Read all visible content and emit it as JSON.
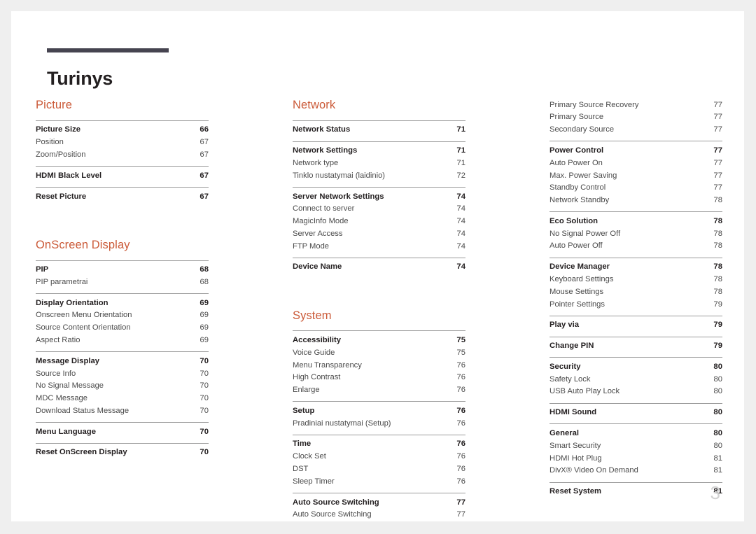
{
  "document": {
    "title": "Turinys",
    "page_number": "3",
    "accent_color": "#cb5a38",
    "rule_color": "#464450"
  },
  "columns": [
    {
      "name": "column-left",
      "sections": [
        {
          "heading": "Picture",
          "groups": [
            {
              "rows": [
                {
                  "label": "Picture Size",
                  "page": "66",
                  "level": "main"
                },
                {
                  "label": "Position",
                  "page": "67",
                  "level": "sub"
                },
                {
                  "label": "Zoom/Position",
                  "page": "67",
                  "level": "sub"
                }
              ]
            },
            {
              "rows": [
                {
                  "label": "HDMI Black Level",
                  "page": "67",
                  "level": "main"
                }
              ]
            },
            {
              "rows": [
                {
                  "label": "Reset Picture",
                  "page": "67",
                  "level": "main"
                }
              ]
            }
          ]
        },
        {
          "heading": "OnScreen Display",
          "groups": [
            {
              "rows": [
                {
                  "label": "PIP",
                  "page": "68",
                  "level": "main"
                },
                {
                  "label": "PIP parametrai",
                  "page": "68",
                  "level": "sub"
                }
              ]
            },
            {
              "rows": [
                {
                  "label": "Display Orientation",
                  "page": "69",
                  "level": "main"
                },
                {
                  "label": "Onscreen Menu Orientation",
                  "page": "69",
                  "level": "sub"
                },
                {
                  "label": "Source Content Orientation",
                  "page": "69",
                  "level": "sub"
                },
                {
                  "label": "Aspect Ratio",
                  "page": "69",
                  "level": "sub"
                }
              ]
            },
            {
              "rows": [
                {
                  "label": "Message Display",
                  "page": "70",
                  "level": "main"
                },
                {
                  "label": "Source Info",
                  "page": "70",
                  "level": "sub"
                },
                {
                  "label": "No Signal Message",
                  "page": "70",
                  "level": "sub"
                },
                {
                  "label": "MDC Message",
                  "page": "70",
                  "level": "sub"
                },
                {
                  "label": "Download Status Message",
                  "page": "70",
                  "level": "sub"
                }
              ]
            },
            {
              "rows": [
                {
                  "label": "Menu Language",
                  "page": "70",
                  "level": "main"
                }
              ]
            },
            {
              "rows": [
                {
                  "label": "Reset OnScreen Display",
                  "page": "70",
                  "level": "main"
                }
              ]
            }
          ]
        }
      ]
    },
    {
      "name": "column-middle",
      "sections": [
        {
          "heading": "Network",
          "groups": [
            {
              "rows": [
                {
                  "label": "Network Status",
                  "page": "71",
                  "level": "main"
                }
              ]
            },
            {
              "rows": [
                {
                  "label": "Network Settings",
                  "page": "71",
                  "level": "main"
                },
                {
                  "label": "Network type",
                  "page": "71",
                  "level": "sub"
                },
                {
                  "label": "Tinklo nustatymai (laidinio)",
                  "page": "72",
                  "level": "sub"
                }
              ]
            },
            {
              "rows": [
                {
                  "label": "Server Network Settings",
                  "page": "74",
                  "level": "main"
                },
                {
                  "label": "Connect to server",
                  "page": "74",
                  "level": "sub"
                },
                {
                  "label": "MagicInfo Mode",
                  "page": "74",
                  "level": "sub"
                },
                {
                  "label": "Server Access",
                  "page": "74",
                  "level": "sub"
                },
                {
                  "label": "FTP Mode",
                  "page": "74",
                  "level": "sub"
                }
              ]
            },
            {
              "rows": [
                {
                  "label": "Device Name",
                  "page": "74",
                  "level": "main"
                }
              ]
            }
          ]
        },
        {
          "heading": "System",
          "groups": [
            {
              "rows": [
                {
                  "label": "Accessibility",
                  "page": "75",
                  "level": "main"
                },
                {
                  "label": "Voice Guide",
                  "page": "75",
                  "level": "sub"
                },
                {
                  "label": "Menu Transparency",
                  "page": "76",
                  "level": "sub"
                },
                {
                  "label": "High Contrast",
                  "page": "76",
                  "level": "sub"
                },
                {
                  "label": "Enlarge",
                  "page": "76",
                  "level": "sub"
                }
              ]
            },
            {
              "rows": [
                {
                  "label": "Setup",
                  "page": "76",
                  "level": "main"
                },
                {
                  "label": "Pradiniai nustatymai (Setup)",
                  "page": "76",
                  "level": "sub"
                }
              ]
            },
            {
              "rows": [
                {
                  "label": "Time",
                  "page": "76",
                  "level": "main"
                },
                {
                  "label": "Clock Set",
                  "page": "76",
                  "level": "sub"
                },
                {
                  "label": "DST",
                  "page": "76",
                  "level": "sub"
                },
                {
                  "label": "Sleep Timer",
                  "page": "76",
                  "level": "sub"
                }
              ]
            },
            {
              "rows": [
                {
                  "label": "Auto Source Switching",
                  "page": "77",
                  "level": "main"
                },
                {
                  "label": "Auto Source Switching",
                  "page": "77",
                  "level": "sub"
                }
              ]
            }
          ]
        }
      ]
    },
    {
      "name": "column-right",
      "sections": [
        {
          "heading": "",
          "groups": [
            {
              "no_rule": true,
              "rows": [
                {
                  "label": "Primary Source Recovery",
                  "page": "77",
                  "level": "sub"
                },
                {
                  "label": "Primary Source",
                  "page": "77",
                  "level": "sub"
                },
                {
                  "label": "Secondary Source",
                  "page": "77",
                  "level": "sub"
                }
              ]
            },
            {
              "rows": [
                {
                  "label": "Power Control",
                  "page": "77",
                  "level": "main"
                },
                {
                  "label": "Auto Power On",
                  "page": "77",
                  "level": "sub"
                },
                {
                  "label": "Max. Power Saving",
                  "page": "77",
                  "level": "sub"
                },
                {
                  "label": "Standby Control",
                  "page": "77",
                  "level": "sub"
                },
                {
                  "label": "Network Standby",
                  "page": "78",
                  "level": "sub"
                }
              ]
            },
            {
              "rows": [
                {
                  "label": "Eco Solution",
                  "page": "78",
                  "level": "main"
                },
                {
                  "label": "No Signal Power Off",
                  "page": "78",
                  "level": "sub"
                },
                {
                  "label": "Auto Power Off",
                  "page": "78",
                  "level": "sub"
                }
              ]
            },
            {
              "rows": [
                {
                  "label": "Device Manager",
                  "page": "78",
                  "level": "main"
                },
                {
                  "label": "Keyboard Settings",
                  "page": "78",
                  "level": "sub"
                },
                {
                  "label": "Mouse Settings",
                  "page": "78",
                  "level": "sub"
                },
                {
                  "label": "Pointer Settings",
                  "page": "79",
                  "level": "sub"
                }
              ]
            },
            {
              "rows": [
                {
                  "label": "Play via",
                  "page": "79",
                  "level": "main"
                }
              ]
            },
            {
              "rows": [
                {
                  "label": "Change PIN",
                  "page": "79",
                  "level": "main"
                }
              ]
            },
            {
              "rows": [
                {
                  "label": "Security",
                  "page": "80",
                  "level": "main"
                },
                {
                  "label": "Safety Lock",
                  "page": "80",
                  "level": "sub"
                },
                {
                  "label": "USB Auto Play Lock",
                  "page": "80",
                  "level": "sub"
                }
              ]
            },
            {
              "rows": [
                {
                  "label": "HDMI Sound",
                  "page": "80",
                  "level": "main"
                }
              ]
            },
            {
              "rows": [
                {
                  "label": "General",
                  "page": "80",
                  "level": "main"
                },
                {
                  "label": "Smart Security",
                  "page": "80",
                  "level": "sub"
                },
                {
                  "label": "HDMI Hot Plug",
                  "page": "81",
                  "level": "sub"
                },
                {
                  "label": "DivX® Video On Demand",
                  "page": "81",
                  "level": "sub"
                }
              ]
            },
            {
              "rows": [
                {
                  "label": "Reset System",
                  "page": "81",
                  "level": "main"
                }
              ]
            }
          ]
        }
      ]
    }
  ]
}
